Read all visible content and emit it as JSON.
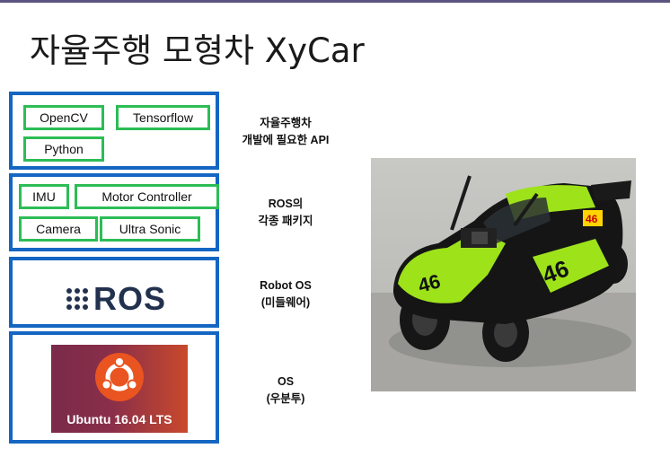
{
  "title": "자율주행 모형차 XyCar",
  "layers": {
    "app": {
      "chips": [
        "OpenCV",
        "Tensorflow",
        "Python"
      ],
      "desc_line1": "자율주행차",
      "desc_line2": "개발에 필요한 API"
    },
    "packages": {
      "chips": [
        "IMU",
        "Motor Controller",
        "Camera",
        "Ultra Sonic"
      ],
      "desc_line1": "ROS의",
      "desc_line2": "각종 패키지"
    },
    "middleware": {
      "logo_text": "ROS",
      "desc_line1": "Robot OS",
      "desc_line2": "(미들웨어)"
    },
    "os": {
      "logo_text": "Ubuntu 16.04 LTS",
      "desc_line1": "OS",
      "desc_line2": "(우분투)"
    }
  },
  "car": {
    "badge_number": "46"
  },
  "colors": {
    "layer_border": "#1466c2",
    "chip_border": "#2cbd55",
    "title_rule": "#5b5380",
    "car_green": "#9ee21a"
  }
}
